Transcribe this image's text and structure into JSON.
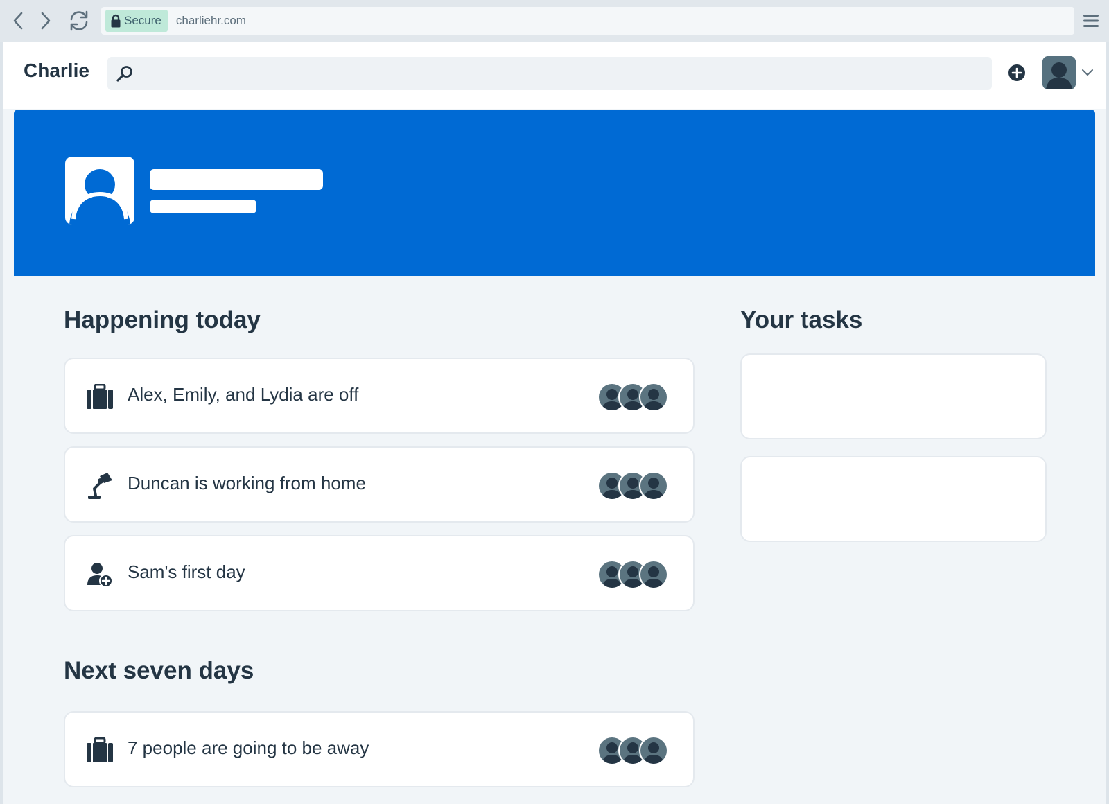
{
  "browser": {
    "secure_label": "Secure",
    "url": "charliehr.com"
  },
  "header": {
    "brand": "Charlie",
    "search_placeholder": ""
  },
  "colors": {
    "brand_blue": "#006ad4",
    "text_dark": "#243544",
    "page_bg": "#f1f5f8",
    "secure_badge_bg": "#bfe9d9"
  },
  "icons": {
    "back": "chevron-left-icon",
    "forward": "chevron-right-icon",
    "reload": "reload-icon",
    "lock": "lock-icon",
    "browser_menu": "hamburger-menu-icon",
    "search": "search-icon",
    "add": "plus-circle-icon",
    "user_menu": "chevron-down-icon",
    "time_off": "suitcase-icon",
    "work_from_home": "desk-lamp-icon",
    "new_starter": "user-plus-icon"
  },
  "happening_today": {
    "title": "Happening today",
    "events": [
      {
        "icon": "suitcase-icon",
        "text": "Alex, Emily, and Lydia are off"
      },
      {
        "icon": "desk-lamp-icon",
        "text": "Duncan is working from home"
      },
      {
        "icon": "user-plus-icon",
        "text": "Sam's first day"
      }
    ]
  },
  "next_seven_days": {
    "title": "Next seven days",
    "events": [
      {
        "icon": "suitcase-icon",
        "text": "7 people are going to be away"
      }
    ]
  },
  "your_tasks": {
    "title": "Your tasks"
  }
}
